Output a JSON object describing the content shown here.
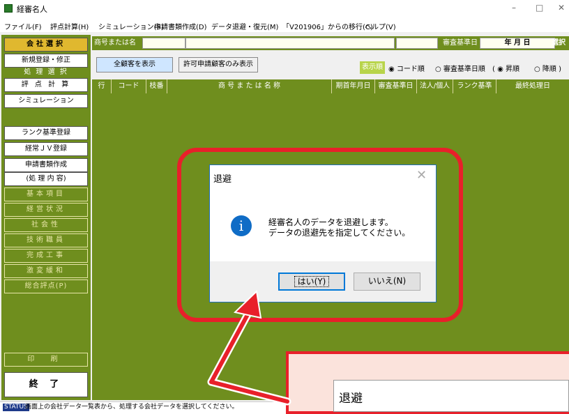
{
  "window": {
    "title": "経審名人",
    "controls": [
      "–",
      "□",
      "✕"
    ]
  },
  "menu": [
    "ファイル(F)",
    "評点計算(H)",
    "シミュレーション(S)",
    "申請書類作成(D)",
    "データ退避・復元(M)",
    "「V201906」からの移行(C)",
    "ヘルプ(V)"
  ],
  "left_panel": {
    "company_select": "会社選択",
    "new_register": "新規登録・修正",
    "process_select_header": "処 理 選 択",
    "score_calc": "評 点 計 算",
    "simulation": "シミュレーション",
    "rank_register": "ランク基準登録",
    "jv_register": "経常ＪＶ登録",
    "application_docs": "申請書類作成",
    "process_contents_header": "(処 理 内 容)",
    "items": [
      "基本項目",
      "経営状況",
      "社会性",
      "技術職員",
      "完成工事",
      "激変緩和",
      "総合評点(P)"
    ],
    "print": "印 刷",
    "exit": "終 了"
  },
  "filter_bar": {
    "name_label": "商号または名称",
    "review_date_label": "審査基準日",
    "date_value": "年 月 日",
    "select_label": "選択"
  },
  "toolbar": {
    "show_all": "全顧客を表示",
    "show_permitted": "許可申請顧客のみ表示",
    "display_order": "表示順",
    "sort_code": "◉ コード順",
    "sort_review": "○ 審査基準日順",
    "sort_asc": "( ◉ 昇順",
    "sort_desc": "○ 降順 )"
  },
  "columns": [
    "行",
    "コード",
    "枝番",
    "商 号 ま た は 名 称",
    "期首年月日",
    "審査基準日",
    "法人/個人",
    "ランク基準",
    "最終処理日"
  ],
  "status": {
    "tag": "STATUS",
    "text": "画面上の会社データ一覧表から、処理する会社データを選択してください。"
  },
  "dialog": {
    "title": "退避",
    "close": "✕",
    "icon": "i",
    "message_line1": "経審名人のデータを退避します。",
    "message_line2": "データの退避先を指定してください。",
    "yes": "はい(Y)",
    "no": "いいえ(N)"
  },
  "zoom": {
    "title": "退避"
  },
  "colors": {
    "panel_green": "#6f8e1e",
    "highlight_red": "#e8202a",
    "info_blue": "#0f6cc6",
    "gold": "#e0b82f"
  }
}
